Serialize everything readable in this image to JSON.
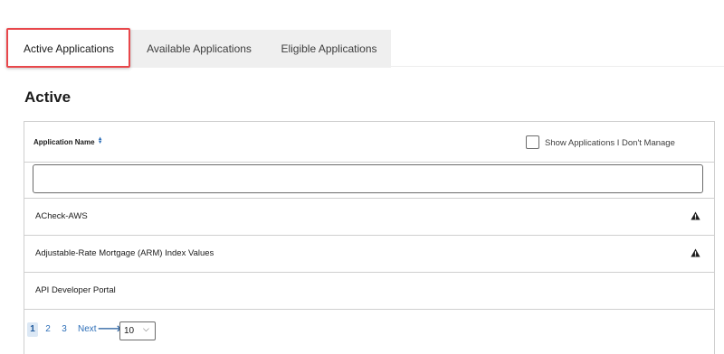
{
  "tabs": [
    {
      "label": "Active Applications",
      "active": true
    },
    {
      "label": "Available Applications",
      "active": false
    },
    {
      "label": "Eligible Applications",
      "active": false
    }
  ],
  "section": {
    "title": "Active"
  },
  "table": {
    "column_name": "Application Name",
    "show_unmanaged_label": "Show Applications I Don't Manage",
    "show_unmanaged_checked": false,
    "filter_value": "",
    "rows": [
      {
        "name": "ACheck-AWS",
        "warning": true,
        "icon": "warning-icon"
      },
      {
        "name": "Adjustable-Rate Mortgage (ARM) Index Values",
        "warning": true,
        "icon": "warning-icon"
      },
      {
        "name": "API Developer Portal",
        "warning": false
      }
    ]
  },
  "pagination": {
    "pages": [
      "1",
      "2",
      "3"
    ],
    "current_page": "1",
    "next_label": "Next",
    "page_size": "10"
  },
  "colors": {
    "highlight": "#e8474b",
    "link": "#2e6fb8",
    "tab_strip": "#efefef"
  }
}
